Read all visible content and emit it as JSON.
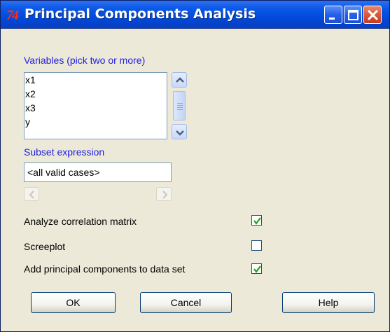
{
  "window": {
    "title": "Principal Components Analysis",
    "app_icon_text": "74"
  },
  "variables": {
    "label": "Variables (pick two or more)",
    "items": [
      "x1",
      "x2",
      "x3",
      "y"
    ]
  },
  "subset": {
    "label": "Subset expression",
    "value": "<all valid cases>"
  },
  "options": [
    {
      "label": "Analyze correlation matrix",
      "checked": true
    },
    {
      "label": "Screeplot",
      "checked": false
    },
    {
      "label": "Add principal components to data set",
      "checked": true
    }
  ],
  "buttons": {
    "ok": "OK",
    "cancel": "Cancel",
    "help": "Help"
  }
}
